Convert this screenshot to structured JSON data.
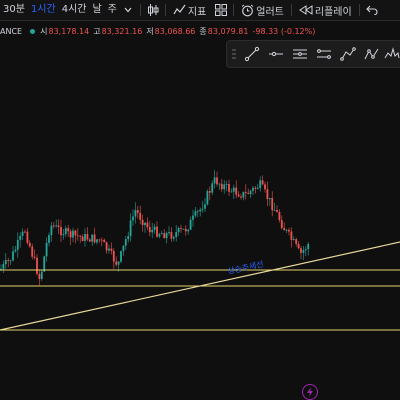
{
  "toolbar": {
    "intervals": [
      "30분",
      "1시간",
      "4시간",
      "날",
      "주"
    ],
    "active_interval": "1시간",
    "indicators_label": "지표",
    "alert_label": "얼러트",
    "replay_label": "리플레이"
  },
  "legend": {
    "symbol": "ANCE",
    "open_label": "시",
    "open": "83,178.14",
    "high_label": "고",
    "high": "83,321.16",
    "low_label": "저",
    "low": "83,068.66",
    "close_label": "종",
    "close": "83,079.81",
    "change": "-98.33 (-0.12%)"
  },
  "drawing_tools": [
    "trend-line",
    "ray",
    "horizontal-lines",
    "parallel-channel",
    "fib-retracement",
    "abcd-pattern",
    "head-shoulders-pattern"
  ],
  "chart": {
    "annotation": "상승추세선",
    "colors": {
      "up": "#26a69a",
      "down": "#ef5350",
      "level_line": "#e3d26a",
      "trend_line": "#e7d79a",
      "annotation": "#2962ff"
    }
  }
}
